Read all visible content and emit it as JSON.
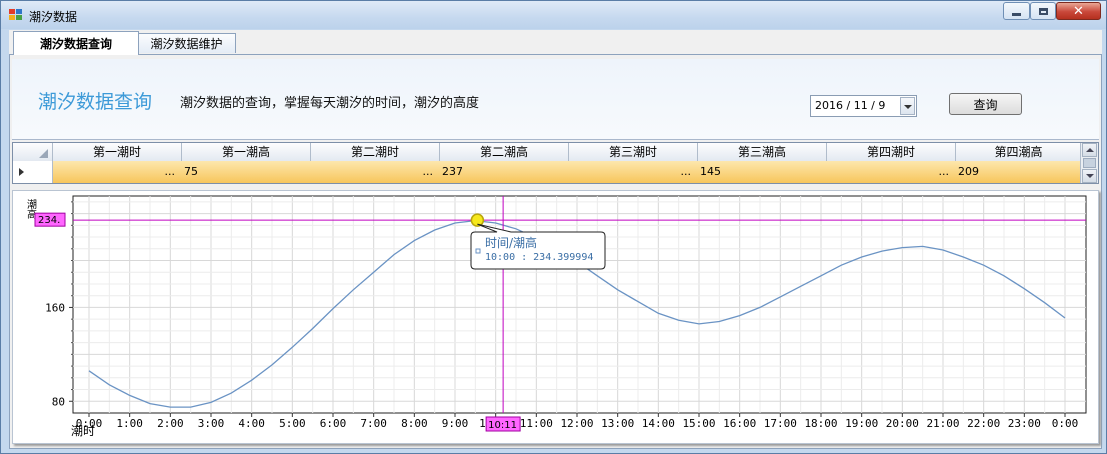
{
  "window": {
    "title": "潮汐数据"
  },
  "tabs": [
    {
      "label": "潮汐数据查询",
      "selected": true
    },
    {
      "label": "潮汐数据维护",
      "selected": false
    }
  ],
  "header": {
    "title": "潮汐数据查询",
    "description": "潮汐数据的查询，掌握每天潮汐的时间，潮汐的高度",
    "date_value": "2016 / 11 / 9",
    "query_label": "查询"
  },
  "grid": {
    "columns": [
      "第一潮时",
      "第一潮高",
      "第二潮时",
      "第二潮高",
      "第三潮时",
      "第三潮高",
      "第四潮时",
      "第四潮高"
    ],
    "row": [
      "...",
      "75",
      "...",
      "237",
      "...",
      "145",
      "...",
      "209"
    ]
  },
  "chart_data": {
    "type": "line",
    "xlabel": "潮时",
    "ylabel": "潮高",
    "x_ticks": [
      "0:00",
      "1:00",
      "2:00",
      "3:00",
      "4:00",
      "5:00",
      "6:00",
      "7:00",
      "8:00",
      "9:00",
      "10:00",
      "11:00",
      "12:00",
      "13:00",
      "14:00",
      "15:00",
      "16:00",
      "17:00",
      "18:00",
      "19:00",
      "20:00",
      "21:00",
      "22:00",
      "23:00",
      "0:00"
    ],
    "y_ticks": [
      80,
      160
    ],
    "ylim": [
      70,
      255
    ],
    "x": [
      0,
      0.5,
      1,
      1.5,
      2,
      2.5,
      3,
      3.5,
      4,
      4.5,
      5,
      5.5,
      6,
      6.5,
      7,
      7.5,
      8,
      8.5,
      9,
      9.5,
      10,
      10.5,
      11,
      11.5,
      12,
      12.5,
      13,
      13.5,
      14,
      14.5,
      15,
      15.5,
      16,
      16.5,
      17,
      17.5,
      18,
      18.5,
      19,
      19.5,
      20,
      20.5,
      21,
      21.5,
      22,
      22.5,
      23,
      23.5,
      24
    ],
    "values": [
      106,
      94,
      85,
      78,
      75,
      75,
      79,
      87,
      98,
      111,
      126,
      142,
      159,
      175,
      190,
      205,
      217,
      226,
      232,
      234,
      232,
      227,
      219,
      210,
      199,
      187,
      175,
      165,
      155,
      149,
      146,
      148,
      153,
      160,
      169,
      178,
      187,
      196,
      203,
      208,
      211,
      212,
      209,
      203,
      196,
      187,
      176,
      164,
      151
    ],
    "cursor": {
      "x_label": "10:11",
      "y_label": "234."
    },
    "tooltip": {
      "title": "时间/潮高",
      "text": "10:00 : 234.399994"
    },
    "grid": true,
    "colors": {
      "line": "#6a93c4",
      "cursor": "#c000c0",
      "marker": "#f6e81c"
    }
  }
}
